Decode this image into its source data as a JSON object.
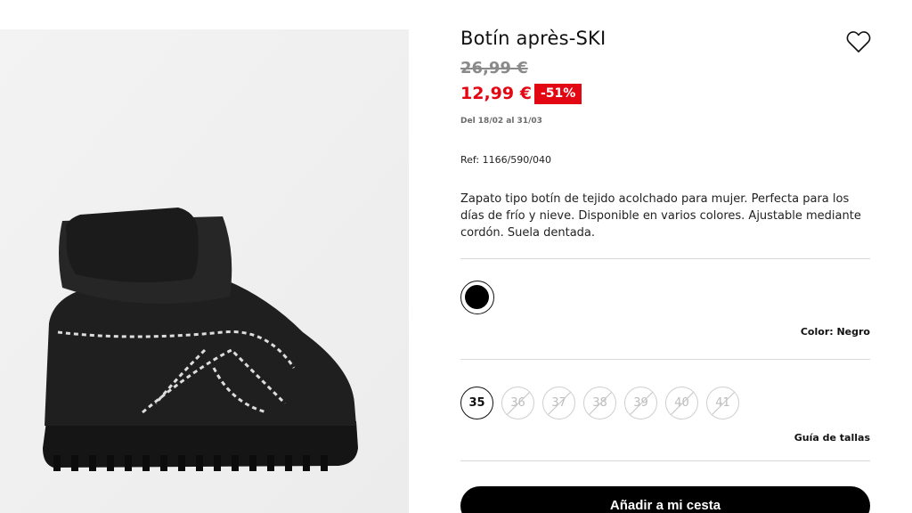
{
  "product": {
    "title": "Botín après-SKI",
    "old_price": "26,99 €",
    "new_price": "12,99 €",
    "discount": "-51%",
    "date_range": "Del 18/02 al 31/03",
    "ref": "Ref: 1166/590/040",
    "description": "Zapato tipo botín de tejido acolchado para mujer. Perfecta para los días de frío y nieve. Disponible en varios colores. Ajustable mediante cordón. Suela dentada.",
    "color_label": "Color: Negro",
    "sizes": [
      {
        "label": "35",
        "available": true
      },
      {
        "label": "36",
        "available": false
      },
      {
        "label": "37",
        "available": false
      },
      {
        "label": "38",
        "available": false
      },
      {
        "label": "39",
        "available": false
      },
      {
        "label": "40",
        "available": false
      },
      {
        "label": "41",
        "available": false
      }
    ],
    "size_guide": "Guía de tallas",
    "add_to_cart": "Añadir a mi cesta",
    "selected_color_hex": "#000000"
  },
  "colors": {
    "accent_red": "#e30613",
    "old_price_grey": "#8a8a8a"
  },
  "icons": {
    "wishlist": "heart-icon"
  }
}
